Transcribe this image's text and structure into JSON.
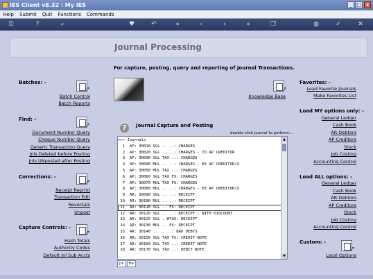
{
  "window": {
    "title": "IES Client v8.32 : My IES",
    "min": "_",
    "max": "□",
    "close": "x"
  },
  "menu": [
    "Help",
    "Submit",
    "Quit",
    "Functions",
    "Commands"
  ],
  "toolbar": [
    "key-icon",
    "help-icon",
    "search-icon",
    "heart-icon",
    "back-icon",
    "first-icon",
    "prev-icon",
    "next-icon",
    "last-icon",
    "copy-icon",
    "globe-icon",
    "ok-icon",
    "close-icon"
  ],
  "page": {
    "title": "Journal Processing",
    "subtitle": "For capture, posting, query and  reporting of Journal Transactions."
  },
  "batches": {
    "heading": "Batches: -",
    "links": [
      "Batch Control",
      "Batch Reports"
    ]
  },
  "find": {
    "heading": "Find: -",
    "links": [
      "Document Number Query",
      "Cheque Number Query",
      "Generic Transaction Query",
      "Jnls Deleted before Posting",
      "Jnls UNposted after Posting"
    ]
  },
  "corrections": {
    "heading": "Corrections: -",
    "links": [
      "Receipt Reprint",
      "Transaction Edit",
      "Reversals",
      "Unpost"
    ]
  },
  "capture_controls": {
    "heading": "Capture Controls: -",
    "links": [
      "Hash Totals",
      "Authority Codes",
      "Default Jnl Sub Accts"
    ]
  },
  "knowledge_base": {
    "label": "Knowledge Base"
  },
  "favorites": {
    "heading": "Favorites: -",
    "links": [
      "Load Favorite Journals",
      "Make Favorites List"
    ]
  },
  "load_my": {
    "heading": "Load MY options only: -",
    "links": [
      "General Ledger",
      "Cash Book",
      "AR Debtors",
      "AP Creditors",
      "Stock",
      "Job Costing",
      "Accounting Control"
    ]
  },
  "load_all": {
    "heading": "Load ALL options: -",
    "links": [
      "General Ledger",
      "Cash Book",
      "AR Debtors",
      "AP Creditors",
      "Stock",
      "Job Costing",
      "Accounting Control"
    ]
  },
  "custom": {
    "heading": "Custom: -",
    "links": [
      "Local Options"
    ]
  },
  "journal_capture": {
    "title": "Journal Capture and Posting",
    "hint": "double-click journal to perform....",
    "header": ">>> Journals",
    "rows": [
      "  1  AP: 30010 SGL .. ..: CHARGES",
      "  2  AP: 30020 SGL .. ..: CHARGES - TO AP CREDITOR",
      "  3  AP: 30030 SGL TAX ..: CHARGES",
      "  4  AP: 30040 MUL .. ..: CHARGES - EX AP CREDITOR(S",
      "  5  AP: 30050 MUL TAX ..: CHARGES",
      "  6  AP: 30060 SGL TAX FX: CHARGES",
      "  7  AP: 30070 MUL TAX FX: CHARGES",
      "  8  AP: 30080 MUL .. ..: CHARGES - EX AP CREDITOR(S",
      "  9  AR: 30090 SGL .. ..: RECEIPT",
      " 10  AR: 30100 MUL .. ..: RECEIPT",
      " 11  AR: 30110 SGL .. FX: RECEIPT",
      " 12  AR: 30120 SGL .. ..: RECEIPT - WITH DISCOUNT",
      " 13  AR: 30125 SGL . WTAX: RECEIPT",
      " 14  AR: 30130 MUL .. FX: RECEIPT",
      " 15  AR: 30140 .. .. ..: BAD DEBTS",
      " 16  AR: 30150 SGL TAX FX: CREDIT NOTE",
      " 17  AR: 30160 SGL TAX ..: CREDIT NOTE",
      " 18  AR: 30170 SGL TAX ..: DEBIT NOTE"
    ],
    "tabs": [
      "jnl",
      "fre"
    ],
    "selected_row": 11
  }
}
